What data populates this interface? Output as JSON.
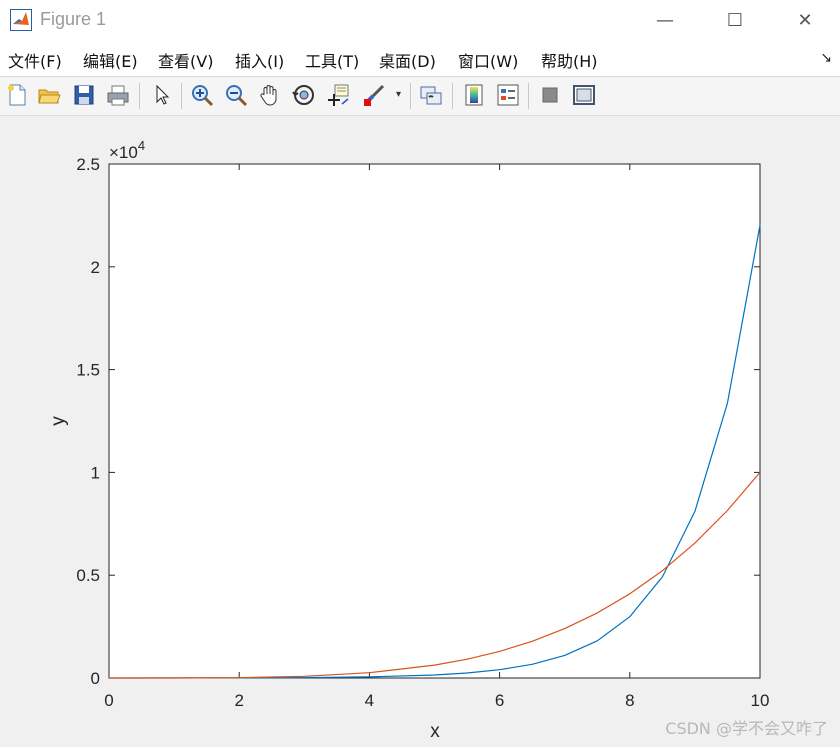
{
  "window": {
    "title": "Figure 1",
    "minimize_glyph": "—",
    "maximize_glyph": "☐",
    "close_glyph": "✕"
  },
  "menu": {
    "items": [
      "文件(F)",
      "编辑(E)",
      "查看(V)",
      "插入(I)",
      "工具(T)",
      "桌面(D)",
      "窗口(W)",
      "帮助(H)"
    ],
    "corner_glyph": "↘"
  },
  "toolbar": {
    "buttons": [
      "new-figure-icon",
      "open-file-icon",
      "save-icon",
      "print-icon",
      "edit-plot-arrow-icon",
      "zoom-in-icon",
      "zoom-out-icon",
      "pan-hand-icon",
      "rotate-3d-icon",
      "data-cursor-icon",
      "brush-icon",
      "link-plot-icon",
      "colorbar-icon",
      "legend-icon",
      "hide-plot-tools-icon",
      "show-plot-tools-icon"
    ]
  },
  "chart_data": {
    "type": "line",
    "xlabel": "x",
    "ylabel": "y",
    "xlim": [
      0,
      10
    ],
    "ylim": [
      0,
      25000
    ],
    "x_ticks": [
      "0",
      "2",
      "4",
      "6",
      "8",
      "10"
    ],
    "y_ticks": [
      "0",
      "0.5",
      "1",
      "1.5",
      "2",
      "2.5"
    ],
    "y_exponent_label": "×10",
    "y_exponent_power": "4",
    "grid": false,
    "x": [
      0,
      1,
      2,
      3,
      4,
      5,
      5.5,
      6,
      6.5,
      7,
      7.5,
      8,
      8.5,
      9,
      9.5,
      10
    ],
    "series": [
      {
        "color": "#0072BD",
        "values": [
          1,
          3,
          7,
          20,
          55,
          148,
          245,
          403,
          665,
          1097,
          1808,
          2981,
          4915,
          8103,
          13360,
          22026
        ]
      },
      {
        "color": "#D95319",
        "values": [
          0,
          1,
          16,
          81,
          256,
          625,
          915,
          1296,
          1785,
          2401,
          3164,
          4096,
          5220,
          6561,
          8145,
          10000
        ]
      }
    ]
  },
  "watermark": "CSDN @学不会又咋了"
}
